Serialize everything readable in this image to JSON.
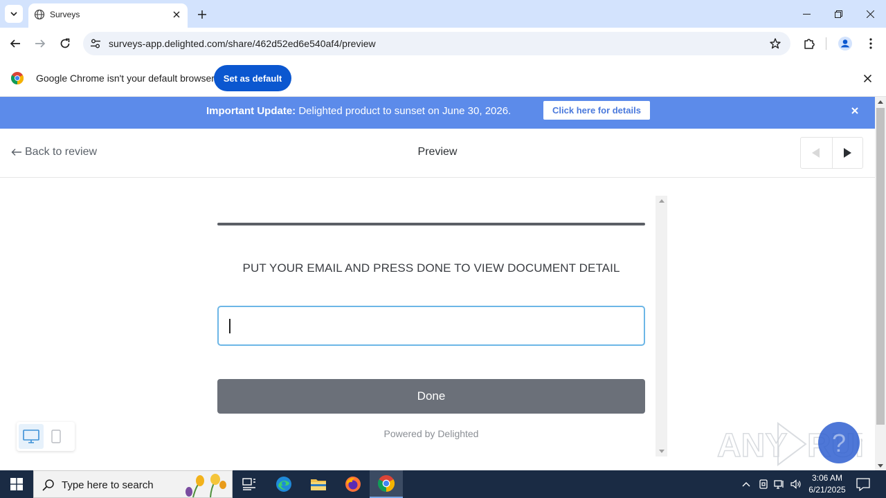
{
  "browser": {
    "tab_title": "Surveys",
    "url": "surveys-app.delighted.com/share/462d52ed6e540af4/preview"
  },
  "infobar": {
    "message": "Google Chrome isn't your default browser",
    "set_default_label": "Set as default"
  },
  "banner": {
    "bold": "Important Update:",
    "message": " Delighted product to sunset on June 30, 2026.",
    "button_label": "Click here for details"
  },
  "header": {
    "back_label": "Back to review",
    "title": "Preview"
  },
  "survey": {
    "question": "PUT YOUR EMAIL AND PRESS DONE TO VIEW DOCUMENT DETAIL",
    "email_value": "",
    "done_label": "Done",
    "powered_by": "Powered by Delighted",
    "progress_fraction": 1.0
  },
  "device_toggle": {
    "selected": "desktop"
  },
  "taskbar": {
    "search_placeholder": "Type here to search",
    "time": "3:06 AM",
    "date": "6/21/2025"
  },
  "colors": {
    "banner": "#5c8bea",
    "chrome_accent": "#0b57d0",
    "done_button": "#6b7079",
    "input_focus": "#6cb6e6",
    "taskbar": "#1a2b44"
  }
}
